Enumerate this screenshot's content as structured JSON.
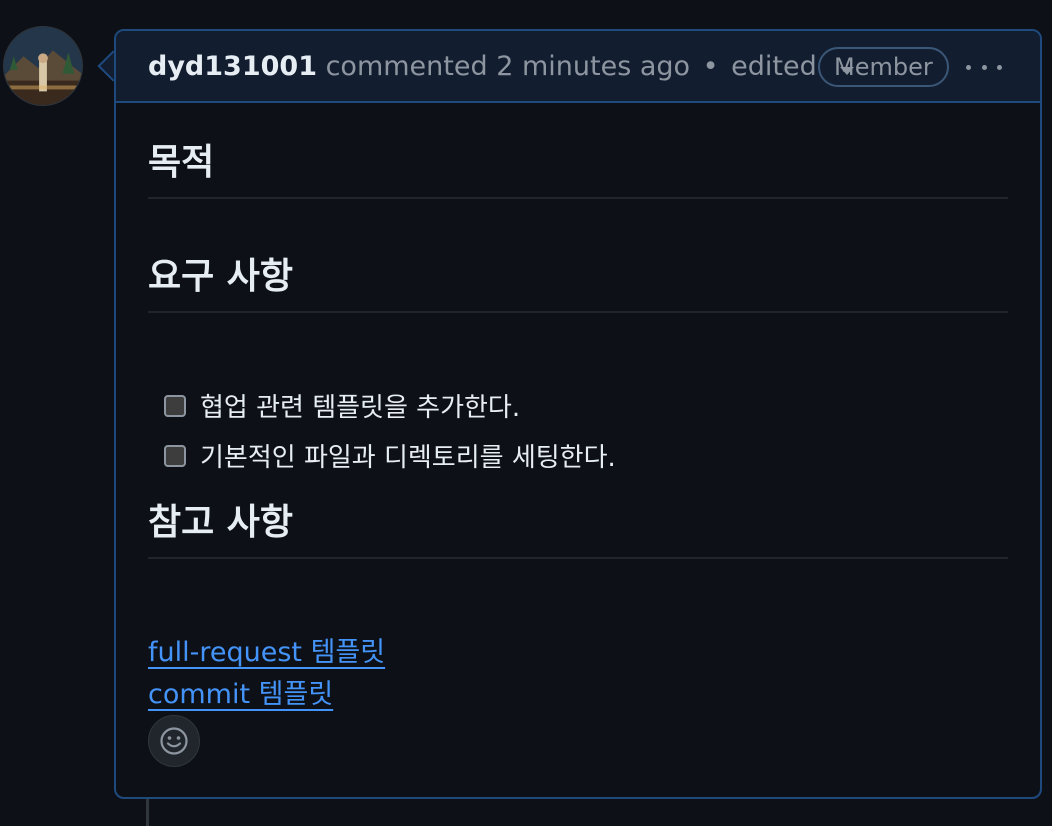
{
  "comment": {
    "author": "dyd131001",
    "action": "commented",
    "time": "2 minutes ago",
    "separator": "•",
    "edited": "edited",
    "badge": "Member"
  },
  "body": {
    "heading_purpose": "목적",
    "heading_requirements": "요구 사항",
    "tasks": [
      {
        "label": "협업 관련 템플릿을 추가한다.",
        "checked": false
      },
      {
        "label": "기본적인 파일과 디렉토리를 세팅한다.",
        "checked": false
      }
    ],
    "heading_references": "참고 사항",
    "links": [
      {
        "label": "full-request 템플릿"
      },
      {
        "label": "commit 템플릿"
      }
    ]
  },
  "icons": {
    "caret": "triangle-down-icon",
    "more": "kebab-horizontal-icon",
    "reaction": "smiley-icon"
  },
  "colors": {
    "background": "#0d1117",
    "header_background": "#121d2f",
    "border": "#1f4a7e",
    "link": "#4493f8",
    "muted_text": "#8d96a0"
  }
}
